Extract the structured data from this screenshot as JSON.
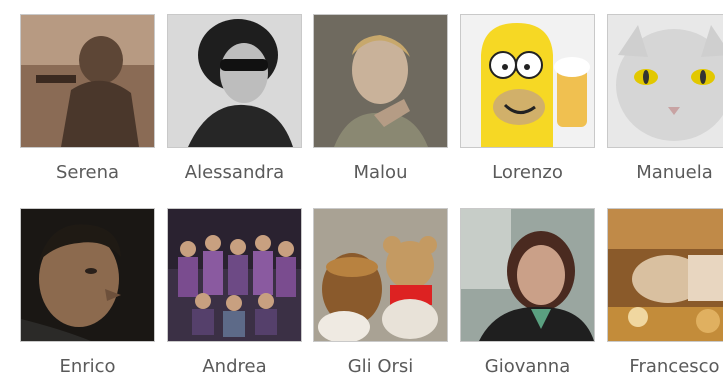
{
  "friends": [
    {
      "name": "Serena",
      "photo": "person-photo-sepia"
    },
    {
      "name": "Alessandra",
      "photo": "person-photo-sunglasses"
    },
    {
      "name": "Malou",
      "photo": "person-photo-woman"
    },
    {
      "name": "Lorenzo",
      "photo": "cartoon-character-image"
    },
    {
      "name": "Manuela",
      "photo": "white-cat-image"
    },
    {
      "name": "Enrico",
      "photo": "person-photo-man"
    },
    {
      "name": "Andrea",
      "photo": "group-photo"
    },
    {
      "name": "Gli Orsi",
      "photo": "teddy-bears-image"
    },
    {
      "name": "Giovanna",
      "photo": "person-photo-woman-outdoors"
    },
    {
      "name": "Francesco",
      "photo": "restaurant-scene-image"
    }
  ]
}
